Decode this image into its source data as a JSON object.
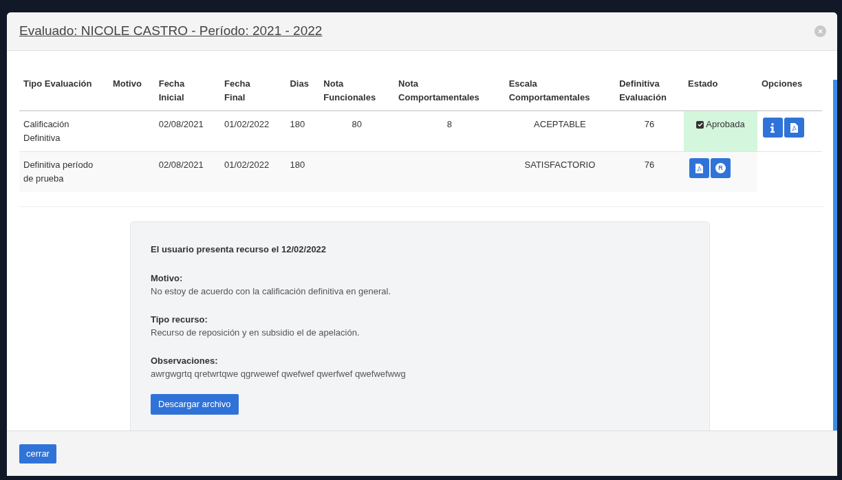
{
  "modal": {
    "title": "Evaluado: NICOLE CASTRO - Período: 2021 - 2022"
  },
  "table": {
    "columns": [
      "Tipo Evaluación",
      "Motivo",
      "Fecha Inicial",
      "Fecha Final",
      "Dias",
      "Nota Funcionales",
      "Nota Comportamentales",
      "Escala Comportamentales",
      "Definitiva Evaluación",
      "Estado",
      "Opciones"
    ],
    "rows": [
      {
        "cells": [
          "Calificación Definitiva",
          "",
          "02/08/2021",
          "01/02/2022",
          "180",
          "80",
          "8",
          "ACEPTABLE",
          "76"
        ],
        "estado": {
          "kind": "status",
          "label": "Aprobada",
          "checked": true
        },
        "options": [
          {
            "kind": "info"
          },
          {
            "kind": "pdf"
          }
        ]
      },
      {
        "cells": [
          "Definitiva período de prueba",
          "",
          "02/08/2021",
          "01/02/2022",
          "180",
          "",
          "",
          "SATISFACTORIO",
          "76"
        ],
        "estado": {
          "kind": "actions",
          "buttons": [
            {
              "kind": "pdf"
            },
            {
              "kind": "letter",
              "text": "R"
            }
          ]
        }
      }
    ]
  },
  "recurso": {
    "heading": "El usuario presenta recurso el 12/02/2022",
    "fields": [
      {
        "label": "Motivo:",
        "value": "No estoy de acuerdo con la calificación definitiva en general."
      },
      {
        "label": "Tipo recurso:",
        "value": "Recurso de reposición y en subsidio el de apelación."
      },
      {
        "label": "Observaciones:",
        "value": "awrgwgrtq qretwrtqwe qgrwewef qwefwef qwerfwef qwefwefwwg"
      }
    ],
    "button": "Descargar archivo"
  },
  "footer": {
    "button": "cerrar"
  }
}
